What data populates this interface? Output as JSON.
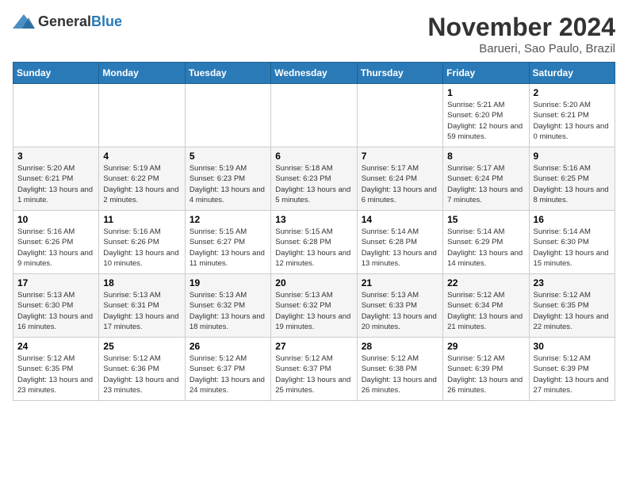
{
  "logo": {
    "general": "General",
    "blue": "Blue"
  },
  "title": "November 2024",
  "subtitle": "Barueri, Sao Paulo, Brazil",
  "days_of_week": [
    "Sunday",
    "Monday",
    "Tuesday",
    "Wednesday",
    "Thursday",
    "Friday",
    "Saturday"
  ],
  "weeks": [
    [
      {
        "day": "",
        "sunrise": "",
        "sunset": "",
        "daylight": ""
      },
      {
        "day": "",
        "sunrise": "",
        "sunset": "",
        "daylight": ""
      },
      {
        "day": "",
        "sunrise": "",
        "sunset": "",
        "daylight": ""
      },
      {
        "day": "",
        "sunrise": "",
        "sunset": "",
        "daylight": ""
      },
      {
        "day": "",
        "sunrise": "",
        "sunset": "",
        "daylight": ""
      },
      {
        "day": "1",
        "sunrise": "Sunrise: 5:21 AM",
        "sunset": "Sunset: 6:20 PM",
        "daylight": "Daylight: 12 hours and 59 minutes."
      },
      {
        "day": "2",
        "sunrise": "Sunrise: 5:20 AM",
        "sunset": "Sunset: 6:21 PM",
        "daylight": "Daylight: 13 hours and 0 minutes."
      }
    ],
    [
      {
        "day": "3",
        "sunrise": "Sunrise: 5:20 AM",
        "sunset": "Sunset: 6:21 PM",
        "daylight": "Daylight: 13 hours and 1 minute."
      },
      {
        "day": "4",
        "sunrise": "Sunrise: 5:19 AM",
        "sunset": "Sunset: 6:22 PM",
        "daylight": "Daylight: 13 hours and 2 minutes."
      },
      {
        "day": "5",
        "sunrise": "Sunrise: 5:19 AM",
        "sunset": "Sunset: 6:23 PM",
        "daylight": "Daylight: 13 hours and 4 minutes."
      },
      {
        "day": "6",
        "sunrise": "Sunrise: 5:18 AM",
        "sunset": "Sunset: 6:23 PM",
        "daylight": "Daylight: 13 hours and 5 minutes."
      },
      {
        "day": "7",
        "sunrise": "Sunrise: 5:17 AM",
        "sunset": "Sunset: 6:24 PM",
        "daylight": "Daylight: 13 hours and 6 minutes."
      },
      {
        "day": "8",
        "sunrise": "Sunrise: 5:17 AM",
        "sunset": "Sunset: 6:24 PM",
        "daylight": "Daylight: 13 hours and 7 minutes."
      },
      {
        "day": "9",
        "sunrise": "Sunrise: 5:16 AM",
        "sunset": "Sunset: 6:25 PM",
        "daylight": "Daylight: 13 hours and 8 minutes."
      }
    ],
    [
      {
        "day": "10",
        "sunrise": "Sunrise: 5:16 AM",
        "sunset": "Sunset: 6:26 PM",
        "daylight": "Daylight: 13 hours and 9 minutes."
      },
      {
        "day": "11",
        "sunrise": "Sunrise: 5:16 AM",
        "sunset": "Sunset: 6:26 PM",
        "daylight": "Daylight: 13 hours and 10 minutes."
      },
      {
        "day": "12",
        "sunrise": "Sunrise: 5:15 AM",
        "sunset": "Sunset: 6:27 PM",
        "daylight": "Daylight: 13 hours and 11 minutes."
      },
      {
        "day": "13",
        "sunrise": "Sunrise: 5:15 AM",
        "sunset": "Sunset: 6:28 PM",
        "daylight": "Daylight: 13 hours and 12 minutes."
      },
      {
        "day": "14",
        "sunrise": "Sunrise: 5:14 AM",
        "sunset": "Sunset: 6:28 PM",
        "daylight": "Daylight: 13 hours and 13 minutes."
      },
      {
        "day": "15",
        "sunrise": "Sunrise: 5:14 AM",
        "sunset": "Sunset: 6:29 PM",
        "daylight": "Daylight: 13 hours and 14 minutes."
      },
      {
        "day": "16",
        "sunrise": "Sunrise: 5:14 AM",
        "sunset": "Sunset: 6:30 PM",
        "daylight": "Daylight: 13 hours and 15 minutes."
      }
    ],
    [
      {
        "day": "17",
        "sunrise": "Sunrise: 5:13 AM",
        "sunset": "Sunset: 6:30 PM",
        "daylight": "Daylight: 13 hours and 16 minutes."
      },
      {
        "day": "18",
        "sunrise": "Sunrise: 5:13 AM",
        "sunset": "Sunset: 6:31 PM",
        "daylight": "Daylight: 13 hours and 17 minutes."
      },
      {
        "day": "19",
        "sunrise": "Sunrise: 5:13 AM",
        "sunset": "Sunset: 6:32 PM",
        "daylight": "Daylight: 13 hours and 18 minutes."
      },
      {
        "day": "20",
        "sunrise": "Sunrise: 5:13 AM",
        "sunset": "Sunset: 6:32 PM",
        "daylight": "Daylight: 13 hours and 19 minutes."
      },
      {
        "day": "21",
        "sunrise": "Sunrise: 5:13 AM",
        "sunset": "Sunset: 6:33 PM",
        "daylight": "Daylight: 13 hours and 20 minutes."
      },
      {
        "day": "22",
        "sunrise": "Sunrise: 5:12 AM",
        "sunset": "Sunset: 6:34 PM",
        "daylight": "Daylight: 13 hours and 21 minutes."
      },
      {
        "day": "23",
        "sunrise": "Sunrise: 5:12 AM",
        "sunset": "Sunset: 6:35 PM",
        "daylight": "Daylight: 13 hours and 22 minutes."
      }
    ],
    [
      {
        "day": "24",
        "sunrise": "Sunrise: 5:12 AM",
        "sunset": "Sunset: 6:35 PM",
        "daylight": "Daylight: 13 hours and 23 minutes."
      },
      {
        "day": "25",
        "sunrise": "Sunrise: 5:12 AM",
        "sunset": "Sunset: 6:36 PM",
        "daylight": "Daylight: 13 hours and 23 minutes."
      },
      {
        "day": "26",
        "sunrise": "Sunrise: 5:12 AM",
        "sunset": "Sunset: 6:37 PM",
        "daylight": "Daylight: 13 hours and 24 minutes."
      },
      {
        "day": "27",
        "sunrise": "Sunrise: 5:12 AM",
        "sunset": "Sunset: 6:37 PM",
        "daylight": "Daylight: 13 hours and 25 minutes."
      },
      {
        "day": "28",
        "sunrise": "Sunrise: 5:12 AM",
        "sunset": "Sunset: 6:38 PM",
        "daylight": "Daylight: 13 hours and 26 minutes."
      },
      {
        "day": "29",
        "sunrise": "Sunrise: 5:12 AM",
        "sunset": "Sunset: 6:39 PM",
        "daylight": "Daylight: 13 hours and 26 minutes."
      },
      {
        "day": "30",
        "sunrise": "Sunrise: 5:12 AM",
        "sunset": "Sunset: 6:39 PM",
        "daylight": "Daylight: 13 hours and 27 minutes."
      }
    ]
  ]
}
